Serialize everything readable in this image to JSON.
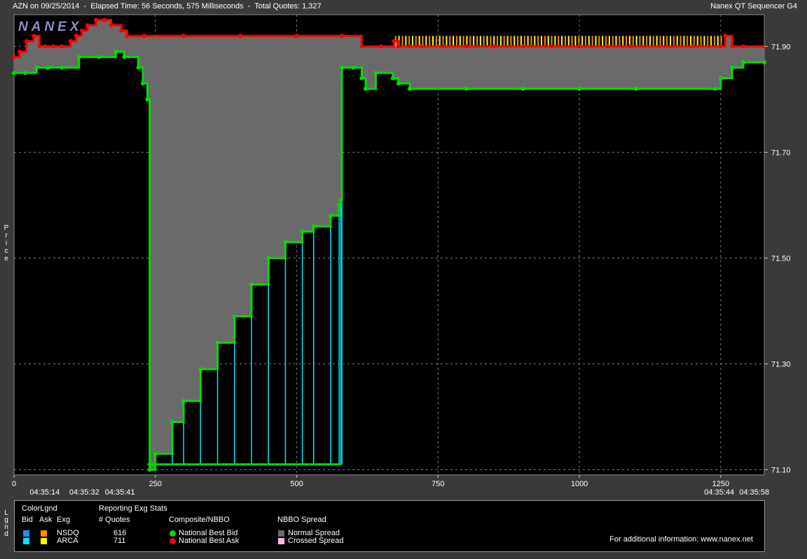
{
  "header": {
    "left": "AZN on 09/25/2014  -  Elapsed Time: 56 Seconds, 575 Milliseconds  -  Total Quotes: 1,327",
    "right": "Nanex QT Sequencer G4"
  },
  "logo": "NANEX",
  "side_labels": {
    "price": "Price",
    "legend": "Lgnd"
  },
  "chart_data": {
    "type": "line",
    "xlabel": "",
    "ylabel": "Price",
    "xlim": [
      0,
      1327
    ],
    "ylim": [
      71.09,
      71.96
    ],
    "x_ticks": [
      0,
      250,
      500,
      750,
      1000,
      1250
    ],
    "y_ticks": [
      71.1,
      71.3,
      71.5,
      71.7,
      71.9
    ],
    "y_tick_labels": [
      "71.10",
      "71.30",
      "71.50",
      "71.70",
      "71.90"
    ],
    "x_tick_labels": [
      "0",
      "250",
      "500",
      "750",
      "1000",
      "1250"
    ],
    "time_labels": [
      {
        "x": 55,
        "label": "04:35:14"
      },
      {
        "x": 125,
        "label": "04:35:32"
      },
      {
        "x": 188,
        "label": "04:35:41"
      },
      {
        "x": 1248,
        "label": "04:35:44"
      },
      {
        "x": 1310,
        "label": "04:35:58"
      }
    ],
    "grid": true,
    "series": [
      {
        "name": "National Best Ask",
        "color": "#ff0000",
        "x": [
          0,
          10,
          22,
          35,
          45,
          55,
          70,
          85,
          100,
          110,
          120,
          130,
          145,
          160,
          172,
          190,
          200,
          230,
          300,
          400,
          500,
          580,
          615,
          650,
          672,
          680,
          700,
          720,
          760,
          800,
          850,
          900,
          950,
          1000,
          1050,
          1090,
          1200,
          1250,
          1258,
          1270,
          1290,
          1327
        ],
        "values": [
          71.88,
          71.89,
          71.91,
          71.92,
          71.9,
          71.9,
          71.9,
          71.9,
          71.91,
          71.92,
          71.93,
          71.94,
          71.95,
          71.95,
          71.94,
          71.93,
          71.92,
          71.92,
          71.92,
          71.92,
          71.92,
          71.92,
          71.9,
          71.9,
          71.91,
          71.9,
          71.9,
          71.9,
          71.9,
          71.9,
          71.9,
          71.9,
          71.9,
          71.9,
          71.9,
          71.9,
          71.9,
          71.9,
          71.92,
          71.9,
          71.9,
          71.9
        ]
      },
      {
        "name": "National Best Bid",
        "color": "#00dd00",
        "x": [
          0,
          20,
          40,
          60,
          85,
          115,
          150,
          180,
          195,
          220,
          228,
          236,
          240,
          250,
          280,
          300,
          330,
          360,
          390,
          420,
          450,
          480,
          510,
          530,
          560,
          575,
          578,
          580,
          600,
          615,
          622,
          640,
          670,
          680,
          700,
          800,
          900,
          1000,
          1100,
          1240,
          1250,
          1270,
          1290,
          1327
        ],
        "values": [
          71.85,
          71.85,
          71.86,
          71.86,
          71.86,
          71.88,
          71.88,
          71.89,
          71.88,
          71.86,
          71.83,
          71.8,
          71.1,
          71.13,
          71.19,
          71.23,
          71.29,
          71.34,
          71.39,
          71.45,
          71.5,
          71.53,
          71.55,
          71.56,
          71.58,
          71.6,
          71.61,
          71.86,
          71.86,
          71.84,
          71.82,
          71.85,
          71.84,
          71.83,
          71.82,
          71.82,
          71.82,
          71.82,
          71.82,
          71.82,
          71.84,
          71.86,
          71.87,
          71.87
        ]
      }
    ]
  },
  "legend": {
    "color_legend": "ColorLgnd",
    "col_bid": "Bid",
    "col_ask": "Ask",
    "col_exg": "Exg",
    "reporting": "Reporting Exg Stats",
    "quotes_header": "# Quotes",
    "composite": "Composite/NBBO",
    "spread": "NBBO Spread",
    "exchanges": [
      {
        "name": "NSDQ",
        "quotes": "616",
        "bid_color": "#1e90ff",
        "ask_color": "#ff8c00"
      },
      {
        "name": "ARCA",
        "quotes": "711",
        "bid_color": "#00e5ff",
        "ask_color": "#ffff00"
      }
    ],
    "nbbo": [
      {
        "label": "National Best Bid",
        "color": "#00dd00"
      },
      {
        "label": "National Best Ask",
        "color": "#ff0000"
      }
    ],
    "spreads": [
      {
        "label": "Normal Spread",
        "color": "#6a6a6a"
      },
      {
        "label": "Crossed Spread",
        "color": "#ffb6e6"
      }
    ],
    "info": "For additional information: www.nanex.net"
  }
}
